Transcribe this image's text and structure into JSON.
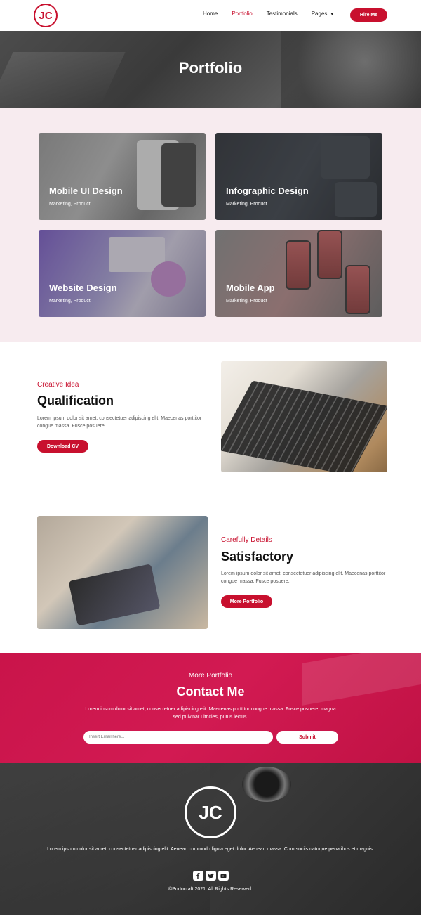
{
  "header": {
    "logo_text": "JC",
    "nav": [
      {
        "label": "Home",
        "active": false
      },
      {
        "label": "Portfolio",
        "active": true
      },
      {
        "label": "Testimonials",
        "active": false
      },
      {
        "label": "Pages",
        "active": false
      }
    ],
    "hire_label": "Hire Me",
    "accent_color": "#c8102e"
  },
  "hero": {
    "title": "Portfolio"
  },
  "portfolio": {
    "cards": [
      {
        "title": "Mobile UI Design",
        "subtitle": "Marketing, Product"
      },
      {
        "title": "Infographic Design",
        "subtitle": "Marketing, Product"
      },
      {
        "title": "Website Design",
        "subtitle": "Marketing, Product"
      },
      {
        "title": "Mobile App",
        "subtitle": "Marketing, Product"
      }
    ]
  },
  "qualification": {
    "label": "Creative Idea",
    "title": "Qualification",
    "text": "Lorem ipsum dolor sit amet, consectetuer adipiscing elit. Maecenas porttitor congue massa. Fusce posuere.",
    "button": "Download CV"
  },
  "satisfactory": {
    "label": "Carefully Details",
    "title": "Satisfactory",
    "text": "Lorem ipsum dolor sit amet, consectetuer adipiscing elit. Maecenas porttitor congue massa. Fusce posuere.",
    "button": "More Portfolio"
  },
  "contact": {
    "label": "More Portfolio",
    "title": "Contact Me",
    "text": "Lorem ipsum dolor sit amet, consectetuer adipiscing elit. Maecenas porttitor congue massa. Fusce posuere, magna sed pulvinar ultricies, purus lectus.",
    "email_placeholder": "Insert Email here...",
    "submit": "Submit"
  },
  "footer": {
    "logo_text": "JC",
    "text": "Lorem ipsum dolor sit amet, consectetuer adipiscing elit. Aenean commodo ligula eget dolor. Aenean massa. Cum sociis natoque penatibus et magnis.",
    "social_icons": [
      "facebook-icon",
      "twitter-icon",
      "youtube-icon"
    ],
    "copyright": "©Portocraft 2021. All Rights Reserved."
  }
}
